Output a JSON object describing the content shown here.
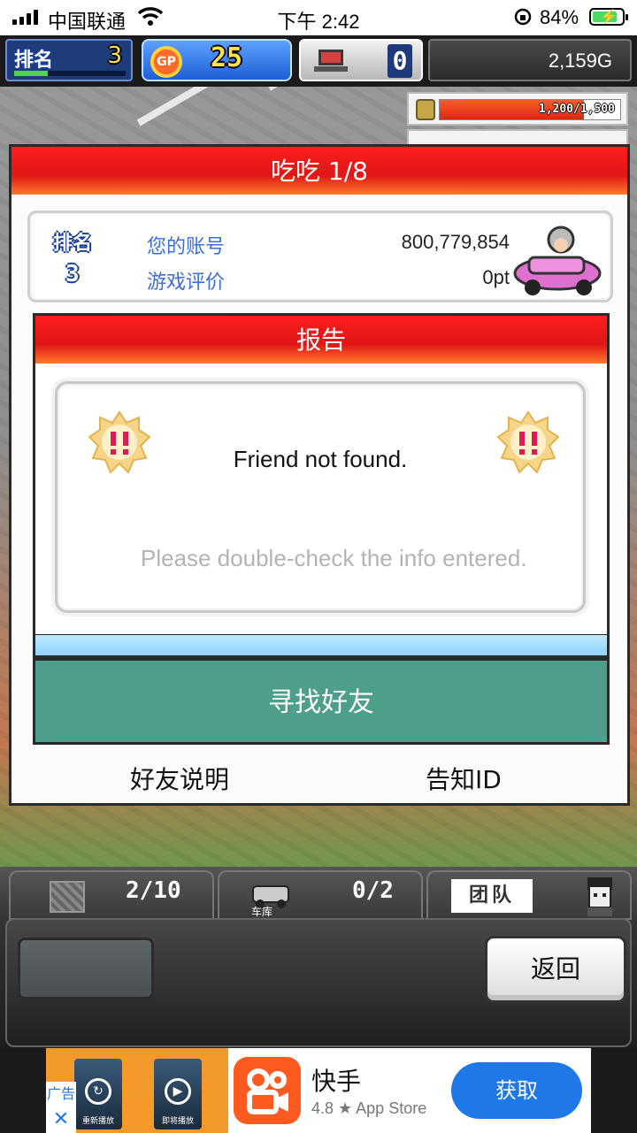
{
  "status_bar": {
    "carrier": "中国联通",
    "time": "下午 2:42",
    "battery_percent": "84%",
    "battery_level": 0.84
  },
  "hud": {
    "rank_label": "排名",
    "rank_value": "3",
    "rank_progress": 0.3,
    "gp_label": "GP",
    "gp_value": "25",
    "pc_value": "0",
    "money": "2,159G",
    "resource_text": "1,200/1,500",
    "resource_fraction": 0.8
  },
  "dialog": {
    "title": "吃吃 1/8",
    "profile": {
      "rank_label": "排名",
      "rank_value": "3",
      "account_label": "您的账号",
      "account_value": "800,779,854",
      "rating_label": "游戏评价",
      "rating_value": "0pt"
    },
    "report": {
      "title": "报告",
      "message": "Friend not found.",
      "hint": "Please double-check the info entered."
    },
    "find_button": "寻找好友",
    "friend_help": "好友说明",
    "notify_id": "告知ID"
  },
  "bottom_hud": {
    "slot1_count": "2/10",
    "slot2_label": "车库",
    "slot2_count": "0/2",
    "team_label": "团队",
    "back_button": "返回"
  },
  "ad": {
    "ad_label": "广告",
    "close": "✕",
    "thumb1_caption": "重新播放",
    "thumb2_caption": "即将播放",
    "app_name": "快手",
    "rating": "4.8 ★ App Store",
    "get_button": "获取"
  },
  "colors": {
    "title_red": "#e01616",
    "find_button_teal": "#4e9e8c",
    "link_blue": "#3b6fd6",
    "get_blue": "#1f78e8"
  }
}
